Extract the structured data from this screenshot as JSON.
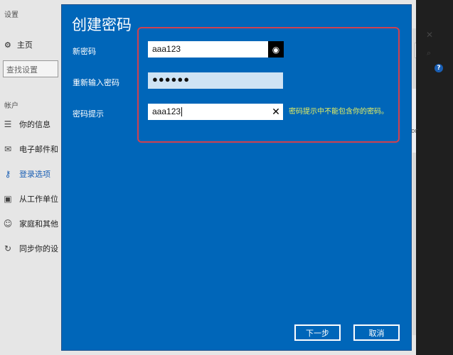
{
  "background": {
    "title": "设置",
    "home_label": "主页",
    "search_placeholder": "查找设置",
    "section_label": "帐户",
    "nav": [
      {
        "label": "你的信息",
        "icon": "user-card-icon"
      },
      {
        "label": "电子邮件和",
        "icon": "mail-icon"
      },
      {
        "label": "登录选项",
        "icon": "key-icon"
      },
      {
        "label": "从工作单位",
        "icon": "briefcase-icon"
      },
      {
        "label": "家庭和其他",
        "icon": "person-icon"
      },
      {
        "label": "同步你的设",
        "icon": "sync-icon"
      }
    ],
    "right_fragment": "or"
  },
  "dialog": {
    "title": "创建密码",
    "fields": {
      "new_password": {
        "label": "新密码",
        "value": "aaa123"
      },
      "confirm_password": {
        "label": "重新输入密码",
        "value": "●●●●●●"
      },
      "hint": {
        "label": "密码提示",
        "value": "aaa123"
      }
    },
    "hint_warning": "密码提示中不能包含你的密码。",
    "buttons": {
      "next": "下一步",
      "cancel": "取消"
    }
  },
  "colors": {
    "dialog_bg": "#0066b9",
    "highlight_border": "#d0414f",
    "warning_text": "#e8f060",
    "active_nav": "#1a5fb4"
  }
}
